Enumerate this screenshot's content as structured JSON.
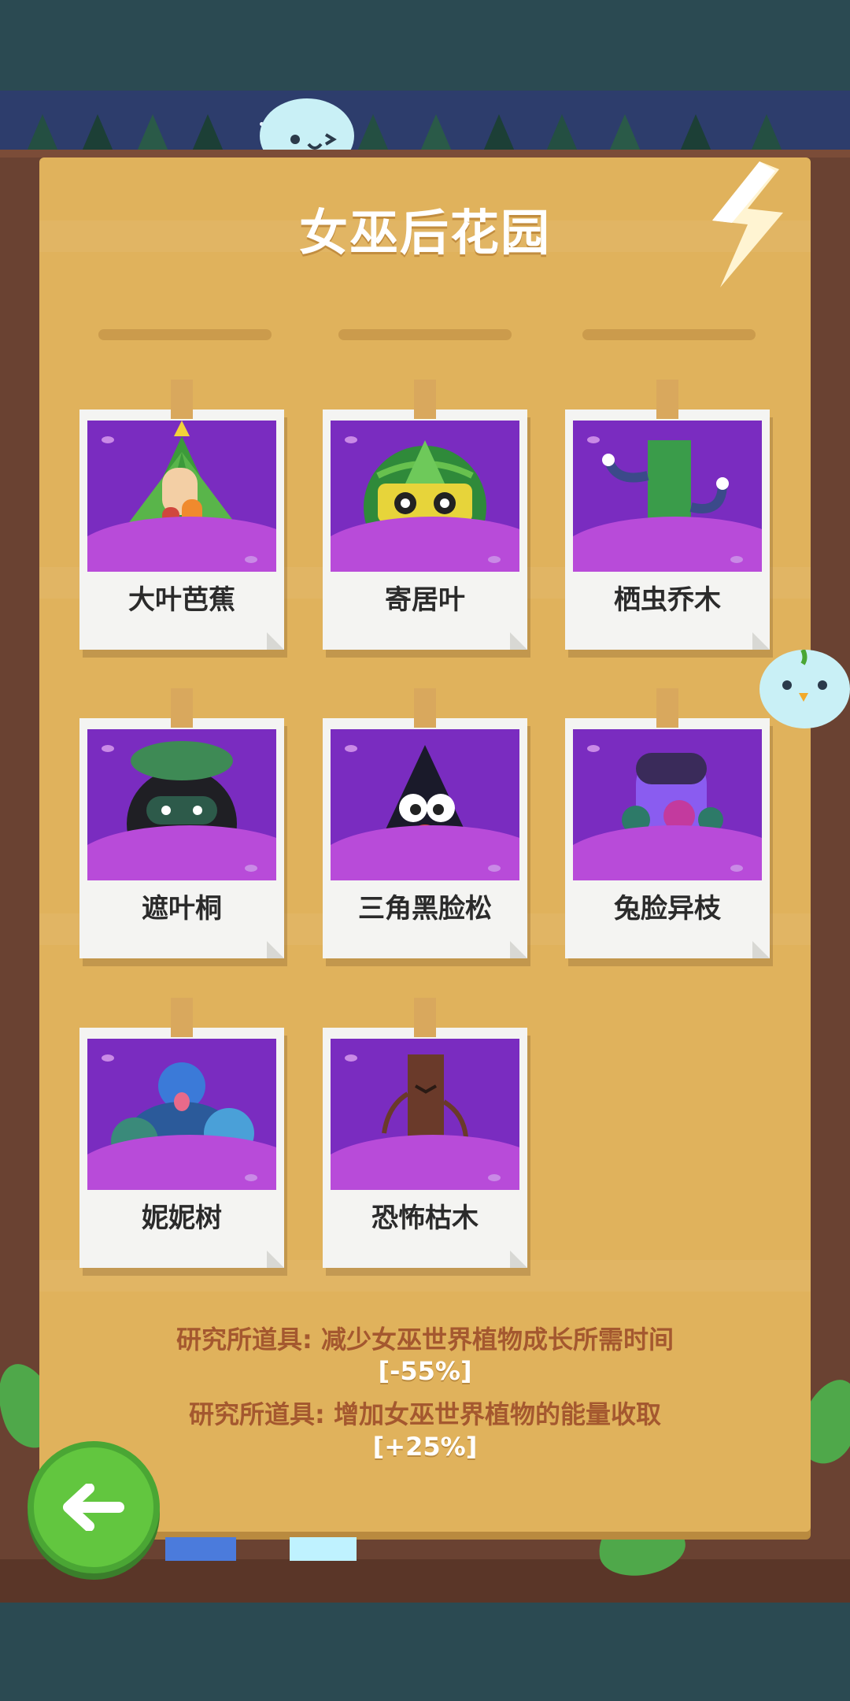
{
  "screen": {
    "title": "女巫后花园",
    "colors": {
      "paper": "#e0b25c",
      "wood": "#6a4232",
      "photo_bg": "#7a2cc0",
      "research_text": "#a4582f",
      "back_button": "#62c63f"
    }
  },
  "plants": [
    {
      "name": "大叶芭蕉"
    },
    {
      "name": "寄居叶"
    },
    {
      "name": "栖虫乔木"
    },
    {
      "name": "遮叶桐"
    },
    {
      "name": "三角黑脸松"
    },
    {
      "name": "兔脸异枝"
    },
    {
      "name": "妮妮树"
    },
    {
      "name": "恐怖枯木"
    }
  ],
  "research": [
    {
      "text": "研究所道具: 减少女巫世界植物成长所需时间",
      "value": "[-55%]"
    },
    {
      "text": "研究所道具: 增加女巫世界植物的能量收取",
      "value": "[+25%]"
    }
  ],
  "controls": {
    "back_icon": "arrow-left-icon"
  }
}
